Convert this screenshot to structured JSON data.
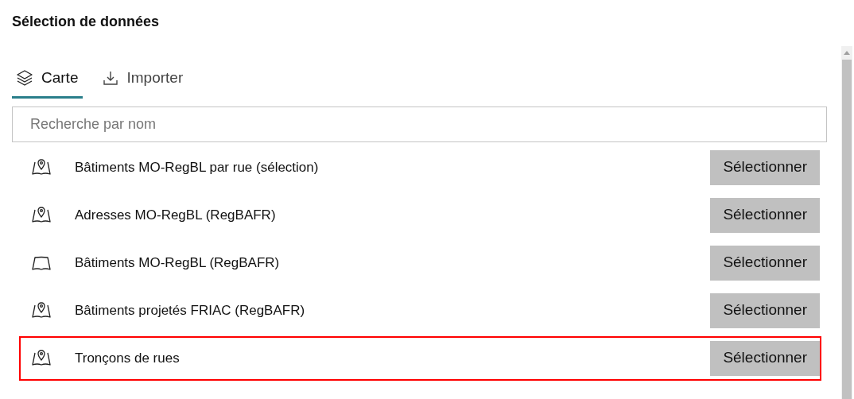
{
  "title": "Sélection de données",
  "tabs": [
    {
      "label": "Carte",
      "kind": "layers",
      "selected": true
    },
    {
      "label": "Importer",
      "kind": "download",
      "selected": false
    }
  ],
  "search": {
    "placeholder": "Recherche par nom"
  },
  "layers": [
    {
      "name": "Bâtiments MO-RegBL par rue (sélection)",
      "kind": "pin",
      "button": "Sélectionner",
      "highlighted": false
    },
    {
      "name": "Adresses MO-RegBL (RegBAFR)",
      "kind": "pin",
      "button": "Sélectionner",
      "highlighted": false
    },
    {
      "name": "Bâtiments MO-RegBL (RegBAFR)",
      "kind": "plain",
      "button": "Sélectionner",
      "highlighted": false
    },
    {
      "name": "Bâtiments projetés FRIAC (RegBAFR)",
      "kind": "pin",
      "button": "Sélectionner",
      "highlighted": false
    },
    {
      "name": "Tronçons de rues",
      "kind": "pin",
      "button": "Sélectionner",
      "highlighted": true
    }
  ]
}
